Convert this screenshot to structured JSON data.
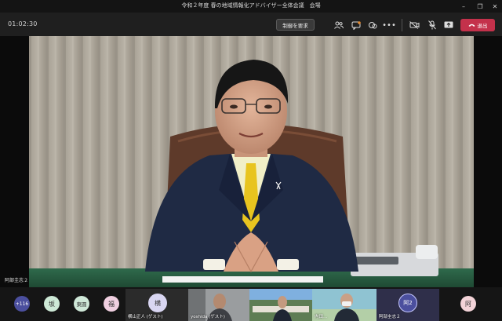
{
  "window": {
    "title": "令和２年度 春の地域情報化アドバイザー全体会議　会場",
    "controls": {
      "minimize": "–",
      "restore": "❐",
      "close": "✕"
    }
  },
  "toolbar": {
    "timer": "01:02:30",
    "control_request_label": "制御を要求",
    "leave_label": "退出",
    "icons": [
      "participants-icon",
      "chat-icon",
      "reactions-icon",
      "more-icon",
      "camera-off-icon",
      "mic-off-icon",
      "share-icon",
      "phone-hangup-icon"
    ]
  },
  "main_video": {
    "speaker_name": "阿部圭志２"
  },
  "participants": {
    "more_count": "+116",
    "avatars": [
      {
        "initial": "坂",
        "color": "#cde9d6"
      },
      {
        "initial": "東圓",
        "color": "#cfe8d8"
      },
      {
        "initial": "福",
        "color": "#f0cfe0"
      },
      {
        "initial": "横",
        "color": "#d9d6f2"
      }
    ],
    "tiles": [
      {
        "label": "横山正人 (ゲスト)"
      },
      {
        "label": "yoshida (ゲスト)"
      },
      {
        "label": ""
      },
      {
        "label": "内田..."
      }
    ],
    "highlight_tile": {
      "initial": "阿2",
      "label": "阿部圭志２"
    },
    "last_avatar": {
      "initial": "阿",
      "color": "#f3d3d8"
    }
  }
}
